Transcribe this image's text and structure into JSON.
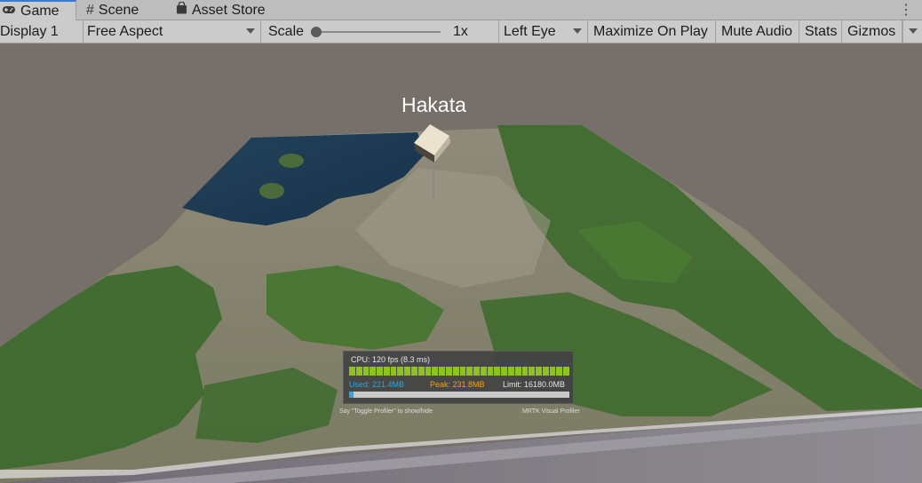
{
  "tabs": {
    "game": "Game",
    "scene": "Scene",
    "asset_store": "Asset Store"
  },
  "toolbar": {
    "display": "Display 1",
    "aspect": "Free Aspect",
    "scale_label": "Scale",
    "scale_value": "1x",
    "eye": "Left Eye",
    "maximize": "Maximize On Play",
    "mute": "Mute Audio",
    "stats": "Stats",
    "gizmos": "Gizmos"
  },
  "scene": {
    "city_label": "Hakata",
    "marker": "cube"
  },
  "profiler": {
    "cpu": "CPU: 120 fps (8.3 ms)",
    "used": "Used: 221.4MB",
    "peak": "Peak: 231.8MB",
    "limit": "Limit: 16180.0MB",
    "used_fraction": 0.0137,
    "hint_left": "Say \"Toggle Profiler\" to show/hide",
    "hint_right": "MRTK Visual Profiler",
    "colors": {
      "cpu_bar": "#8dc21f",
      "used": "#29a7e1",
      "peak": "#f0a21a"
    }
  },
  "icons": {
    "game_tab": "gamepad-icon",
    "scene_tab": "hash-icon",
    "asset_store_tab": "bag-icon",
    "menu": "kebab-menu-icon"
  }
}
